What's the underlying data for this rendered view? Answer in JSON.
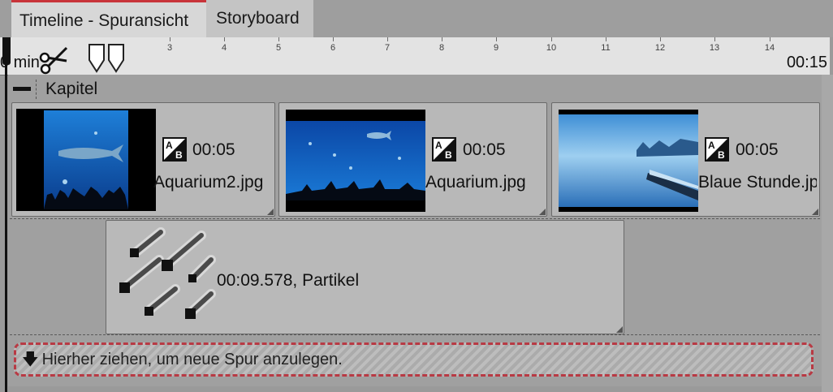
{
  "tabs": [
    {
      "label": "Timeline - Spuransicht",
      "active": true
    },
    {
      "label": "Storyboard",
      "active": false
    }
  ],
  "ruler": {
    "ticks": [
      "3",
      "4",
      "5",
      "6",
      "7",
      "8",
      "9",
      "10",
      "11",
      "12",
      "13",
      "14"
    ],
    "start_label": "0 min",
    "end_label": "00:15"
  },
  "group": {
    "label": "Kapitel"
  },
  "clips": [
    {
      "duration": "00:05",
      "name": "Aquarium2.jpg",
      "thumb": "aquarium-whale-shark"
    },
    {
      "duration": "00:05",
      "name": "Aquarium.jpg",
      "thumb": "aquarium-wide"
    },
    {
      "duration": "00:05",
      "name": "Blaue Stunde.jpg",
      "thumb": "lake-boat-blue-hour"
    }
  ],
  "effect": {
    "label": "00:09.578, Partikel",
    "icon": "particles-icon"
  },
  "dropzone": {
    "label": "Hierher ziehen, um neue Spur anzulegen.",
    "icon": "arrow-down-icon"
  },
  "colors": {
    "active_tab_accent": "#c8343a",
    "dropzone_border": "#b83a44"
  }
}
